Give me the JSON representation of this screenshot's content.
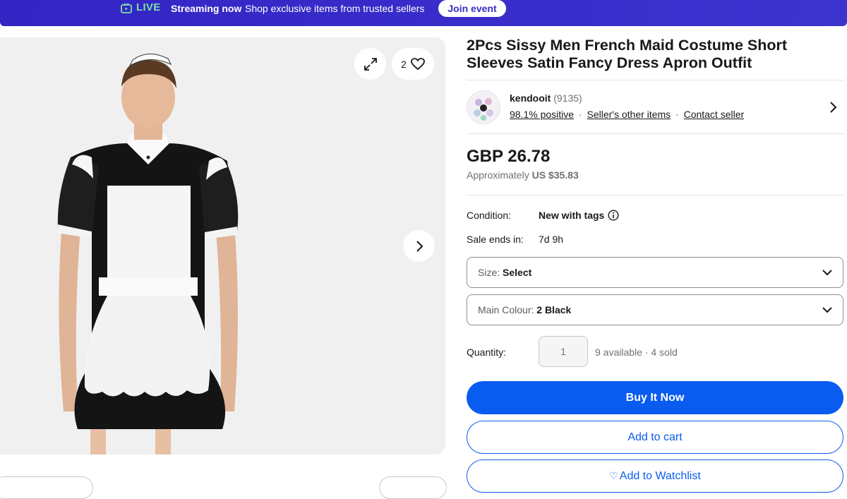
{
  "banner": {
    "live_label": "LIVE",
    "streaming_label": "Streaming now",
    "streaming_text": "Shop exclusive items from trusted sellers",
    "join_label": "Join event"
  },
  "gallery": {
    "watch_count": "2",
    "icons": [
      "expand-icon",
      "heart-icon",
      "chevron-right-icon"
    ]
  },
  "listing": {
    "title": "2Pcs Sissy Men French Maid Costume Short Sleeves Satin Fancy Dress Apron Outfit"
  },
  "seller": {
    "name": "kendooit",
    "feedback_count": "(9135)",
    "positive": "98.1% positive",
    "other_items": "Seller's other items",
    "contact": "Contact seller",
    "separator": "·"
  },
  "price": {
    "main": "GBP 26.78",
    "approx_prefix": "Approximately",
    "approx_value": "US $35.83"
  },
  "details": {
    "condition_label": "Condition:",
    "condition_value": "New with tags",
    "sale_label": "Sale ends in:",
    "sale_value": "7d 9h"
  },
  "options": {
    "size_label": "Size:",
    "size_value": "Select",
    "colour_label": "Main Colour:",
    "colour_value": "2 Black"
  },
  "quantity": {
    "label": "Quantity:",
    "placeholder": "1",
    "availability": "9 available · 4 sold"
  },
  "actions": {
    "buy_now": "Buy It Now",
    "add_to_cart": "Add to cart",
    "watchlist_icon": "♡",
    "add_to_watchlist": "Add to Watchlist"
  },
  "colors": {
    "banner_bg": "#3a2ec7",
    "live_green": "#7de0a6",
    "primary_blue": "#0a5cf0"
  }
}
